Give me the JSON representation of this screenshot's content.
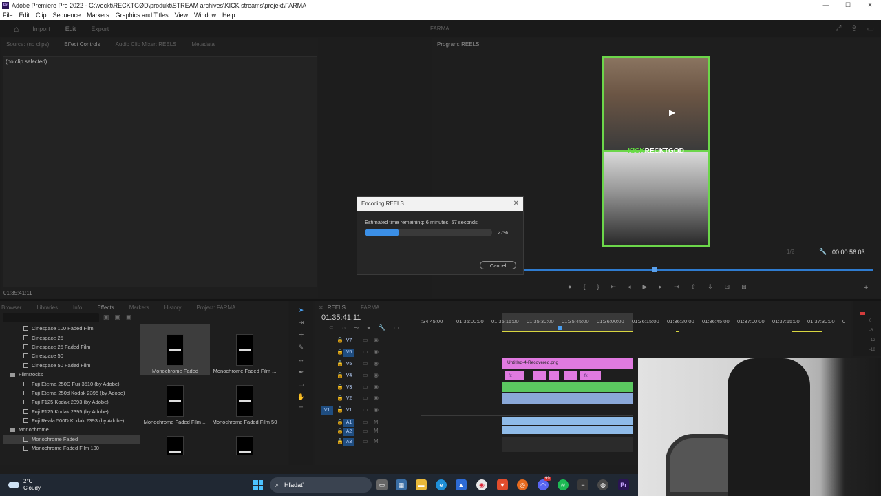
{
  "window": {
    "title": "Adobe Premiere Pro 2022 - G:\\veckt\\RECKTGØD\\produkt\\STREAM archives\\KICK streams\\projekt\\FARMA",
    "app_icon": "Pr"
  },
  "menu": [
    "File",
    "Edit",
    "Clip",
    "Sequence",
    "Markers",
    "Graphics and Titles",
    "View",
    "Window",
    "Help"
  ],
  "workspace": {
    "tabs": [
      "Import",
      "Edit",
      "Export"
    ],
    "active": "Edit",
    "project_name": "FARMA"
  },
  "source_panel": {
    "tabs": [
      "Source: (no clips)",
      "Effect Controls",
      "Audio Clip Mixer: REELS",
      "Metadata"
    ],
    "active_tab": "Effect Controls",
    "no_clip": "(no clip selected)",
    "timecode": "01:35:41:11"
  },
  "program_panel": {
    "tab": "Program: REELS",
    "overlay_brand": "KICK",
    "overlay_name": "RECKTGOD",
    "fit": "1/2",
    "timecode": "00:00:56:03"
  },
  "project_panel": {
    "tabs": [
      "Browser",
      "Libraries",
      "Info",
      "Effects",
      "Markers",
      "History",
      "Project: FARMA"
    ],
    "active_tab": "Effects",
    "tree": [
      {
        "type": "item",
        "label": "Cinespace 100 Faded Film"
      },
      {
        "type": "item",
        "label": "Cinespace 25"
      },
      {
        "type": "item",
        "label": "Cinespace 25 Faded Film"
      },
      {
        "type": "item",
        "label": "Cinespace 50"
      },
      {
        "type": "item",
        "label": "Cinespace 50 Faded Film"
      },
      {
        "type": "folder",
        "label": "Filmstocks"
      },
      {
        "type": "item",
        "label": "Fuji Eterna 250D Fuji 3510 (by Adobe)"
      },
      {
        "type": "item",
        "label": "Fuji Eterna 250d Kodak 2395 (by Adobe)"
      },
      {
        "type": "item",
        "label": "Fuji F125 Kodak 2393 (by Adobe)"
      },
      {
        "type": "item",
        "label": "Fuji F125 Kodak 2395 (by Adobe)"
      },
      {
        "type": "item",
        "label": "Fuji Reala 500D Kodak 2393 (by Adobe)"
      },
      {
        "type": "folder",
        "label": "Monochrome"
      },
      {
        "type": "item",
        "label": "Monochrome Faded",
        "selected": true
      },
      {
        "type": "item",
        "label": "Monochrome Faded Film 100"
      }
    ],
    "thumbs": [
      "Monochrome Faded",
      "Monochrome Faded Film ...",
      "Monochrome Faded Film ...",
      "Monochrome Faded Film 50",
      "",
      ""
    ]
  },
  "timeline": {
    "tabs": [
      "REELS",
      "FARMA"
    ],
    "timecode": "01:35:41:11",
    "ruler": [
      ":34:45:00",
      "01:35:00:00",
      "01:35:15:00",
      "01:35:30:00",
      "01:35:45:00",
      "01:36:00:00",
      "01:36:15:00",
      "01:36:30:00",
      "01:36:45:00",
      "01:37:00:00",
      "01:37:15:00",
      "01:37:30:00",
      "0"
    ],
    "tracks": [
      "V7",
      "V6",
      "V5",
      "V4",
      "V3",
      "V2",
      "V1",
      "A1",
      "A2",
      "A3"
    ],
    "source_patch_v": "V1",
    "clip_label": "Untitled-4-Recovered.png",
    "clip_fx": "fx"
  },
  "meters": [
    "0",
    "-6",
    "-12",
    "-18"
  ],
  "dialog": {
    "title": "Encoding REELS",
    "eta": "Estimated time remaining: 6 minutes, 57 seconds",
    "progress": 27,
    "percent_label": "27%",
    "cancel": "Cancel"
  },
  "taskbar": {
    "temp": "2°C",
    "condition": "Cloudy",
    "search": "Hľadať",
    "badge": "99"
  },
  "colors": {
    "accent": "#3b8fe6",
    "clip_pink": "#e07ae0",
    "clip_green": "#5bc860",
    "clip_blue": "#8aa8d8",
    "frame_green": "#6cd64a"
  }
}
